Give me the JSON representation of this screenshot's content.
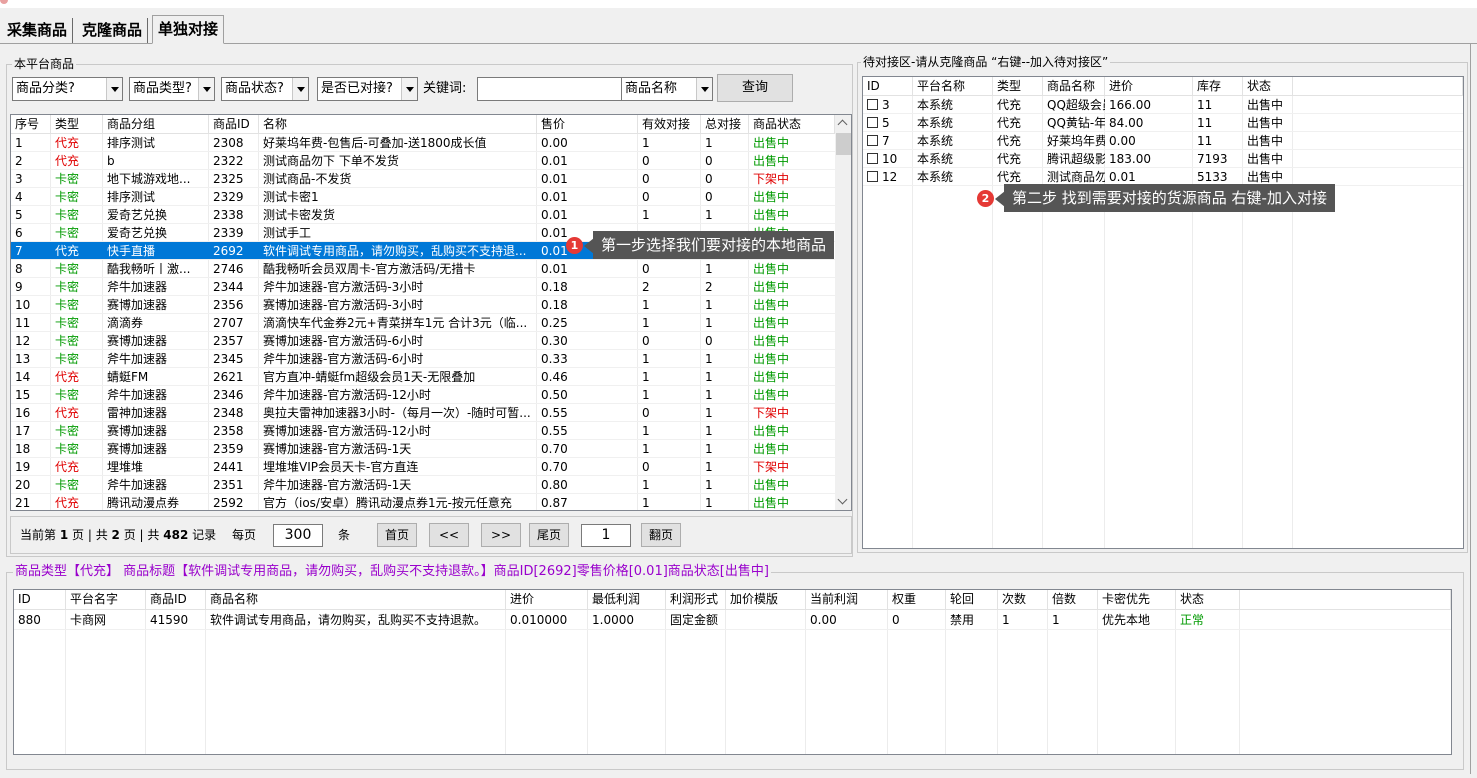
{
  "tabs": [
    "采集商品",
    "克隆商品",
    "单独对接"
  ],
  "left_panel": {
    "title": "本平台商品",
    "filters": {
      "category": "商品分类?",
      "type": "商品类型?",
      "status": "商品状态?",
      "docked": "是否已对接?",
      "keyword_label": "关键词:",
      "keyword_value": "",
      "search_field": "商品名称",
      "query_button": "查询"
    },
    "columns": [
      "序号",
      "类型",
      "商品分组",
      "商品ID",
      "名称",
      "售价",
      "有效对接",
      "总对接",
      "商品状态"
    ],
    "rows": [
      [
        "1",
        "代充",
        "排序测试",
        "2308",
        "好莱坞年费-包售后-可叠加-送1800成长值",
        "0.00",
        "1",
        "1",
        "出售中"
      ],
      [
        "2",
        "代充",
        "b",
        "2322",
        "测试商品勿下 下单不发货",
        "0.01",
        "0",
        "0",
        "出售中"
      ],
      [
        "3",
        "卡密",
        "地下城游戏地...",
        "2325",
        "测试商品-不发货",
        "0.01",
        "0",
        "0",
        "下架中"
      ],
      [
        "4",
        "卡密",
        "排序测试",
        "2329",
        "测试卡密1",
        "0.01",
        "0",
        "0",
        "出售中"
      ],
      [
        "5",
        "卡密",
        "爱奇艺兑换",
        "2338",
        "测试卡密发货",
        "0.01",
        "1",
        "1",
        "出售中"
      ],
      [
        "6",
        "卡密",
        "爱奇艺兑换",
        "2339",
        "测试手工",
        "0.01",
        "",
        "",
        "出售中"
      ],
      [
        "7",
        "代充",
        "快手直播",
        "2692",
        "软件调试专用商品，请勿购买，乱购买不支持退...",
        "0.01",
        "",
        "",
        "出售中"
      ],
      [
        "8",
        "卡密",
        "酷我畅听丨激...",
        "2746",
        "酷我畅听会员双周卡-官方激活码/无措卡",
        "0.01",
        "0",
        "1",
        "出售中"
      ],
      [
        "9",
        "卡密",
        "斧牛加速器",
        "2344",
        "斧牛加速器-官方激活码-3小时",
        "0.18",
        "2",
        "2",
        "出售中"
      ],
      [
        "10",
        "卡密",
        "赛博加速器",
        "2356",
        "赛博加速器-官方激活码-3小时",
        "0.18",
        "1",
        "1",
        "出售中"
      ],
      [
        "11",
        "卡密",
        "滴滴券",
        "2707",
        "滴滴快车代金券2元+青菜拼车1元 合计3元（临...",
        "0.25",
        "1",
        "1",
        "出售中"
      ],
      [
        "12",
        "卡密",
        "赛博加速器",
        "2357",
        "赛博加速器-官方激活码-6小时",
        "0.30",
        "0",
        "0",
        "出售中"
      ],
      [
        "13",
        "卡密",
        "斧牛加速器",
        "2345",
        "斧牛加速器-官方激活码-6小时",
        "0.33",
        "1",
        "1",
        "出售中"
      ],
      [
        "14",
        "代充",
        "蜻蜓FM",
        "2621",
        "官方直冲-蜻蜓fm超级会员1天-无限叠加",
        "0.46",
        "1",
        "1",
        "出售中"
      ],
      [
        "15",
        "卡密",
        "斧牛加速器",
        "2346",
        "斧牛加速器-官方激活码-12小时",
        "0.50",
        "1",
        "1",
        "出售中"
      ],
      [
        "16",
        "代充",
        "雷神加速器",
        "2348",
        "奥拉夫雷神加速器3小时-（每月一次）-随时可暂...",
        "0.55",
        "0",
        "1",
        "下架中"
      ],
      [
        "17",
        "卡密",
        "赛博加速器",
        "2358",
        "赛博加速器-官方激活码-12小时",
        "0.55",
        "1",
        "1",
        "出售中"
      ],
      [
        "18",
        "卡密",
        "赛博加速器",
        "2359",
        "赛博加速器-官方激活码-1天",
        "0.70",
        "1",
        "1",
        "出售中"
      ],
      [
        "19",
        "代充",
        "埋堆堆",
        "2441",
        "埋堆堆VIP会员天卡-官方直连",
        "0.70",
        "0",
        "1",
        "下架中"
      ],
      [
        "20",
        "卡密",
        "斧牛加速器",
        "2351",
        "斧牛加速器-官方激活码-1天",
        "0.80",
        "1",
        "1",
        "出售中"
      ],
      [
        "21",
        "代充",
        "腾讯动漫点券",
        "2592",
        "官方（ios/安卓）腾讯动漫点券1元-按元任意充",
        "0.87",
        "1",
        "1",
        "出售中"
      ]
    ],
    "pager": {
      "summary_prefix": "当前第",
      "current_page": "1",
      "page_word": "页 | 共",
      "total_pages": "2",
      "page_word2": "页 | 共",
      "total_records": "482",
      "records_word": "记录",
      "per_page_label": "每页",
      "per_page_value": "300",
      "per_page_unit": "条",
      "first": "首页",
      "prev": "<<",
      "next": ">>",
      "last": "尾页",
      "page_input": "1",
      "go": "翻页"
    }
  },
  "right_panel": {
    "title": "待对接区-请从克隆商品 “右键--加入待对接区”",
    "columns": [
      "ID",
      "平台名称",
      "类型",
      "商品名称",
      "进价",
      "库存",
      "状态"
    ],
    "rows": [
      [
        "3",
        "本系统",
        "代充",
        "QQ超级会员年费-包售...",
        "166.00",
        "11",
        "出售中"
      ],
      [
        "5",
        "本系统",
        "代充",
        "QQ黄钻-年费-包售后-...",
        "84.00",
        "11",
        "出售中"
      ],
      [
        "7",
        "本系统",
        "代充",
        "好莱坞年费-包售后-可...",
        "0.00",
        "11",
        "出售中"
      ],
      [
        "10",
        "本系统",
        "代充",
        "腾讯超级影视年-云视听...",
        "183.00",
        "7193",
        "出售中"
      ],
      [
        "12",
        "本系统",
        "代充",
        "测试商品勿下 下单不发货",
        "0.01",
        "5133",
        "出售中"
      ]
    ]
  },
  "tooltips": {
    "step1_badge": "1",
    "step1": "第一步选择我们要对接的本地商品",
    "step2_badge": "2",
    "step2": "第二步 找到需要对接的货源商品 右键-加入对接"
  },
  "bottom_panel": {
    "info": "商品类型【代充】 商品标题【软件调试专用商品，请勿购买，乱购买不支持退款。】商品ID[2692]零售价格[0.01]商品状态[出售中]",
    "columns": [
      "ID",
      "平台名字",
      "商品ID",
      "商品名称",
      "进价",
      "最低利润",
      "利润形式",
      "加价模版",
      "当前利润",
      "权重",
      "轮回",
      "次数",
      "倍数",
      "卡密优先",
      "状态"
    ],
    "rows": [
      [
        "880",
        "卡商网",
        "41590",
        "软件调试专用商品，请勿购买，乱购买不支持退款。",
        "0.010000",
        "1.0000",
        "固定金额",
        "",
        "0.00",
        "0",
        "禁用",
        "1",
        "1",
        "优先本地",
        "正常"
      ]
    ]
  },
  "colors": {
    "green": "#009a00",
    "red": "#e00000",
    "selection": "#0078d7",
    "info_text": "#9900cc",
    "tooltip_bg": "#555555",
    "badge": "#e53935"
  }
}
